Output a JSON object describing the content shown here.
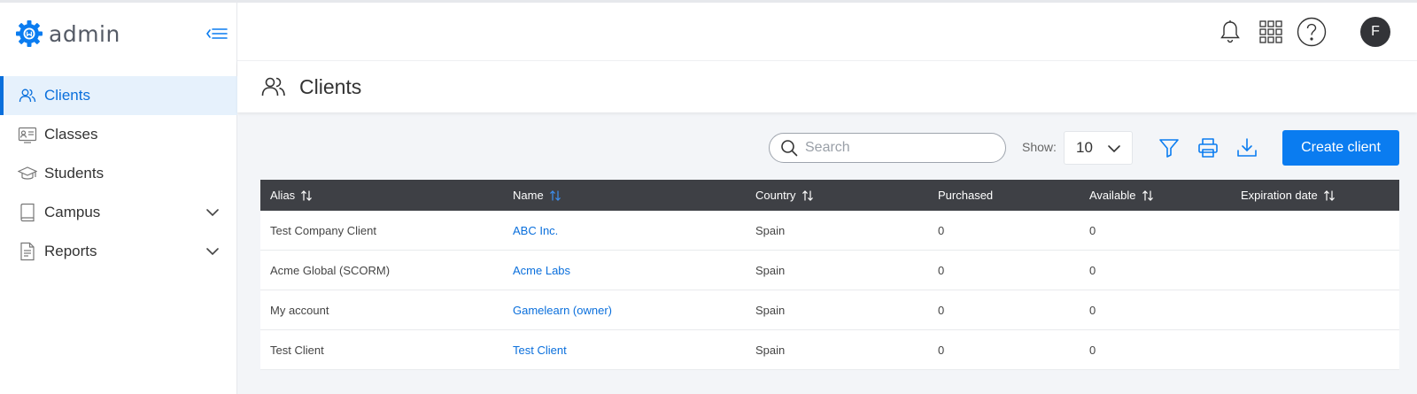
{
  "app": {
    "name": "admin"
  },
  "colors": {
    "accent": "#0a7cf0",
    "active_bg": "#e6f1fc",
    "table_header_bg": "#3e4045",
    "avatar_bg": "#333438"
  },
  "sidebar": {
    "items": [
      {
        "label": "Clients",
        "icon": "users-icon",
        "active": true,
        "expandable": false
      },
      {
        "label": "Classes",
        "icon": "id-card-icon",
        "active": false,
        "expandable": false
      },
      {
        "label": "Students",
        "icon": "graduation-cap-icon",
        "active": false,
        "expandable": false
      },
      {
        "label": "Campus",
        "icon": "book-icon",
        "active": false,
        "expandable": true
      },
      {
        "label": "Reports",
        "icon": "document-icon",
        "active": false,
        "expandable": true
      }
    ]
  },
  "header": {
    "icons": [
      "bell-icon",
      "apps-grid-icon",
      "help-icon"
    ],
    "avatar_initial": "F"
  },
  "page": {
    "title": "Clients",
    "icon": "users-icon"
  },
  "toolbar": {
    "search_placeholder": "Search",
    "show_label": "Show:",
    "show_value": "10",
    "icons": [
      "filter-icon",
      "print-icon",
      "download-icon"
    ],
    "create_label": "Create client"
  },
  "table": {
    "columns": [
      {
        "label": "Alias",
        "sortable": true
      },
      {
        "label": "Name",
        "sortable": true,
        "sorted": true
      },
      {
        "label": "Country",
        "sortable": true
      },
      {
        "label": "Purchased",
        "sortable": false
      },
      {
        "label": "Available",
        "sortable": true
      },
      {
        "label": "Expiration date",
        "sortable": true
      }
    ],
    "rows": [
      {
        "alias": "Test Company Client",
        "name": "ABC Inc.",
        "country": "Spain",
        "purchased": "0",
        "available": "0",
        "expiration": ""
      },
      {
        "alias": "Acme Global (SCORM)",
        "name": "Acme Labs",
        "country": "Spain",
        "purchased": "0",
        "available": "0",
        "expiration": ""
      },
      {
        "alias": "My account",
        "name": "Gamelearn (owner)",
        "country": "Spain",
        "purchased": "0",
        "available": "0",
        "expiration": ""
      },
      {
        "alias": "Test Client",
        "name": "Test Client",
        "country": "Spain",
        "purchased": "0",
        "available": "0",
        "expiration": ""
      }
    ]
  }
}
